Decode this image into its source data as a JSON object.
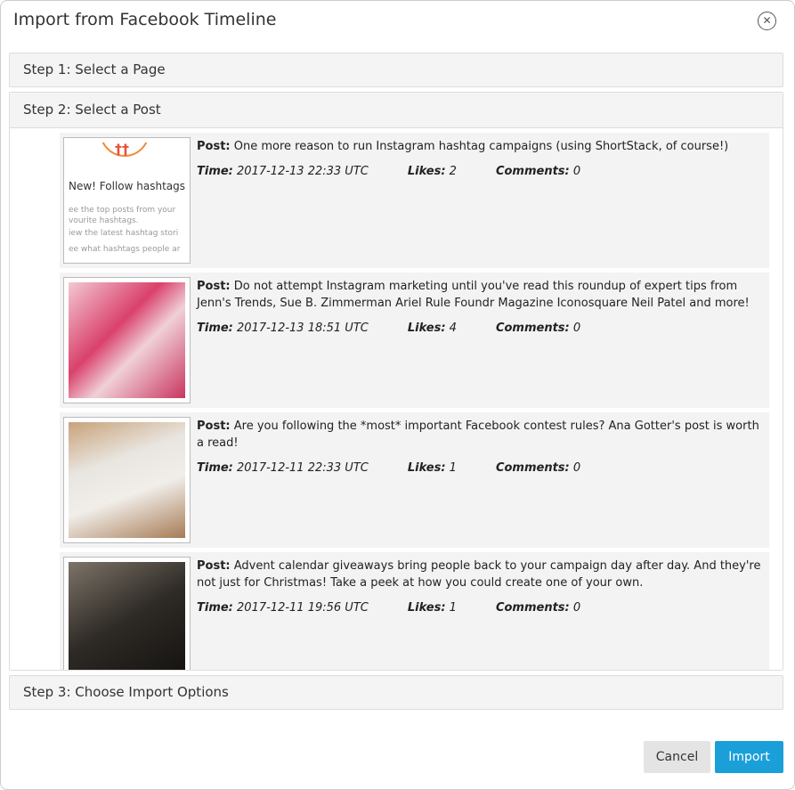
{
  "dialog": {
    "title": "Import from Facebook Timeline",
    "close_icon": "close-circle-icon"
  },
  "steps": [
    {
      "label": "Step 1: Select a Page"
    },
    {
      "label": "Step 2: Select a Post"
    },
    {
      "label": "Step 3: Choose Import Options"
    }
  ],
  "labels": {
    "post": "Post:",
    "time": "Time:",
    "likes": "Likes:",
    "comments": "Comments:"
  },
  "posts": [
    {
      "text": "One more reason to run Instagram hashtag campaigns (using ShortStack, of course!)",
      "time": "2017-12-13 22:33 UTC",
      "likes": "2",
      "comments": "0",
      "thumb_text": [
        "New! Follow hashtags",
        "ee the top posts from your vourite hashtags.",
        "iew the latest hashtag stori",
        "ee what hashtags people ar"
      ]
    },
    {
      "text": "Do not attempt Instagram marketing until you've read this roundup of expert tips from Jenn's Trends, Sue B. Zimmerman Ariel Rule Foundr Magazine Iconosquare Neil Patel and more!",
      "time": "2017-12-13 18:51 UTC",
      "likes": "4",
      "comments": "0"
    },
    {
      "text": "Are you following the *most* important Facebook contest rules? Ana Gotter's post is worth a read!",
      "time": "2017-12-11 22:33 UTC",
      "likes": "1",
      "comments": "0"
    },
    {
      "text": "Advent calendar giveaways bring people back to your campaign day after day. And they're not just for Christmas! Take a peek at how you could create one of your own.",
      "time": "2017-12-11 19:56 UTC",
      "likes": "1",
      "comments": "0"
    }
  ],
  "buttons": {
    "cancel": "Cancel",
    "import": "Import"
  },
  "colors": {
    "primary": "#1a9fd9"
  }
}
